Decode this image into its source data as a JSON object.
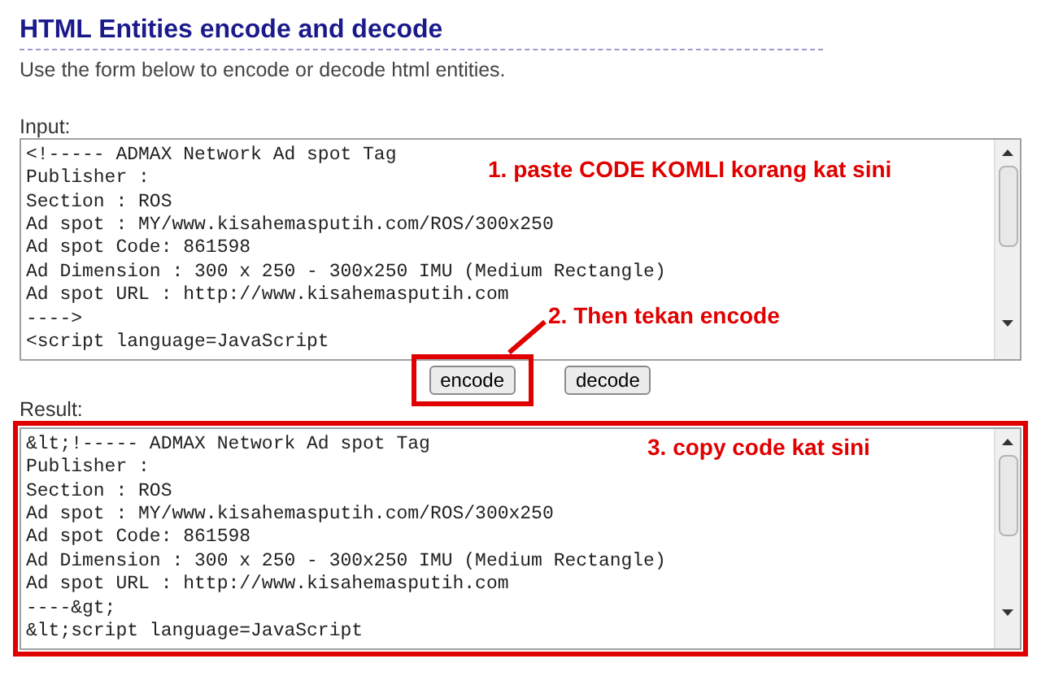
{
  "header": {
    "title": "HTML Entities encode and decode",
    "subtitle": "Use the form below to encode or decode html entities."
  },
  "input": {
    "label": "Input:",
    "lines": [
      "<!----- ADMAX Network Ad spot Tag",
      "Publisher :",
      "Section : ROS",
      "Ad spot : MY/www.kisahemasputih.com/ROS/300x250",
      "Ad spot Code: 861598",
      "Ad Dimension : 300 x 250 - 300x250 IMU (Medium Rectangle)",
      "Ad spot URL : http://www.kisahemasputih.com",
      "---->",
      "<script language=JavaScript"
    ]
  },
  "buttons": [
    {
      "label": "encode",
      "highlighted": true
    },
    {
      "label": "decode",
      "highlighted": false
    }
  ],
  "result": {
    "label": "Result:",
    "highlighted": true,
    "lines": [
      "&lt;!----- ADMAX Network Ad spot Tag",
      "Publisher :",
      "Section : ROS",
      "Ad spot : MY/www.kisahemasputih.com/ROS/300x250",
      "Ad spot Code: 861598",
      "Ad Dimension : 300 x 250 - 300x250 IMU (Medium Rectangle)",
      "Ad spot URL : http://www.kisahemasputih.com",
      "----&gt;",
      "&lt;script language=JavaScript"
    ]
  },
  "annotations": [
    "1. paste CODE KOMLI korang kat sini",
    "2. Then tekan encode",
    "3. copy code kat sini"
  ]
}
